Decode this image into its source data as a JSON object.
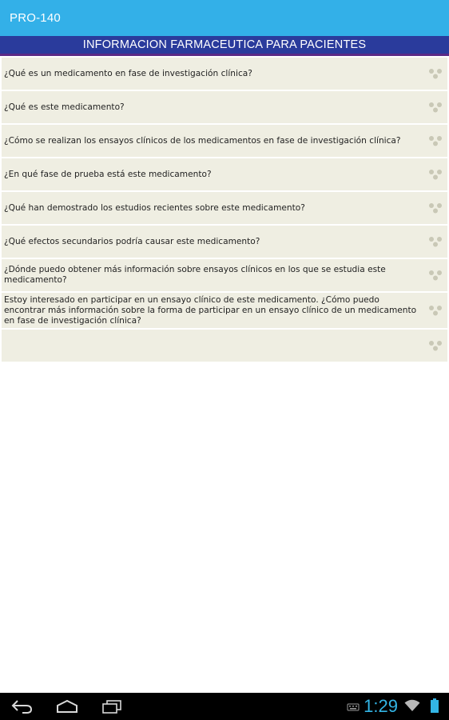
{
  "app": {
    "title": "PRO-140"
  },
  "header": {
    "title": "INFORMACION FARMACEUTICA PARA PACIENTES"
  },
  "items": [
    {
      "label": "¿Qué es un medicamento en fase de investigación clínica?"
    },
    {
      "label": "¿Qué es este medicamento?"
    },
    {
      "label": "¿Cómo se realizan los ensayos clínicos de los medicamentos en fase de investigación clínica?"
    },
    {
      "label": "¿En qué fase de prueba está este medicamento?"
    },
    {
      "label": "¿Qué han demostrado los estudios recientes sobre este medicamento?"
    },
    {
      "label": "¿Qué efectos secundarios podría causar este medicamento?"
    },
    {
      "label": "¿Dónde puedo obtener más información sobre ensayos clínicos en los que se estudia este medicamento?"
    },
    {
      "label": "Estoy interesado en participar en un ensayo clínico de este medicamento. ¿Cómo puedo encontrar más información sobre la forma de participar en un ensayo clínico de un medicamento en fase de investigación clínica?"
    },
    {
      "label": ""
    }
  ],
  "status_bar": {
    "time": "1:29"
  },
  "icons": {
    "item_icon": "dots-icon",
    "nav": [
      "back-icon",
      "home-icon",
      "recent-apps-icon"
    ],
    "status": [
      "keyboard-icon",
      "wifi-icon",
      "battery-icon"
    ]
  },
  "colors": {
    "app_bar": "#33b0e8",
    "header": "#2a3b9c",
    "header_border": "#5b2a86",
    "item_background": "#efeee2",
    "clock": "#33b5e5"
  }
}
